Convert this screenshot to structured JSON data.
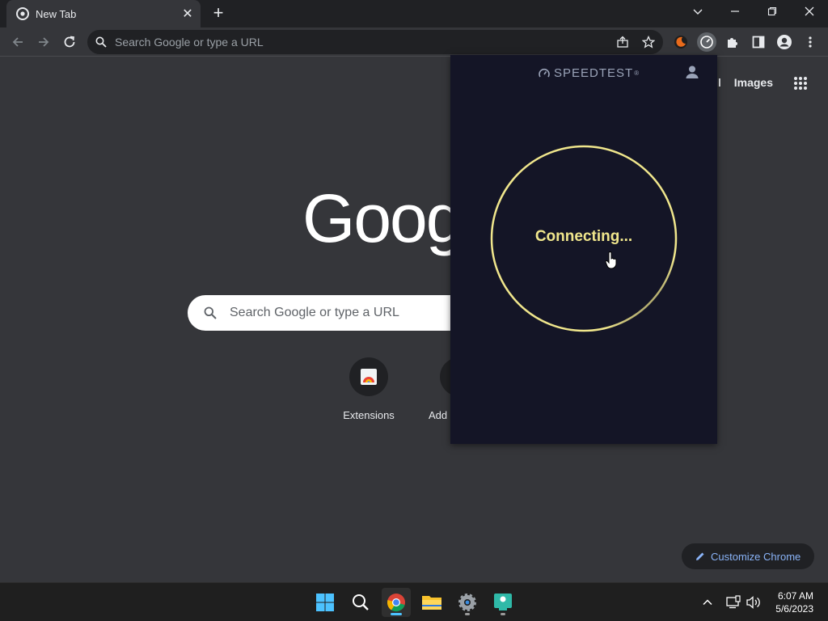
{
  "browser": {
    "tab_title": "New Tab",
    "new_tab_symbol": "+",
    "omnibox_placeholder": "Search Google or type a URL"
  },
  "ntp": {
    "links": [
      "ail",
      "Images"
    ],
    "logo_text": "Goog",
    "search_placeholder": "Search Google or type a URL",
    "shortcuts": [
      {
        "label": "Extensions"
      },
      {
        "label": "Add"
      }
    ],
    "customize_label": "Customize Chrome"
  },
  "speedtest": {
    "brand": "SPEEDTEST",
    "status": "Connecting...",
    "ring_color": "#f0e68c"
  },
  "taskbar": {
    "time": "6:07 AM",
    "date": "5/6/2023"
  },
  "colors": {
    "titlebar": "#202124",
    "toolbar": "#35363a",
    "popup_bg": "#141526",
    "accent_link": "#8ab4f8"
  }
}
